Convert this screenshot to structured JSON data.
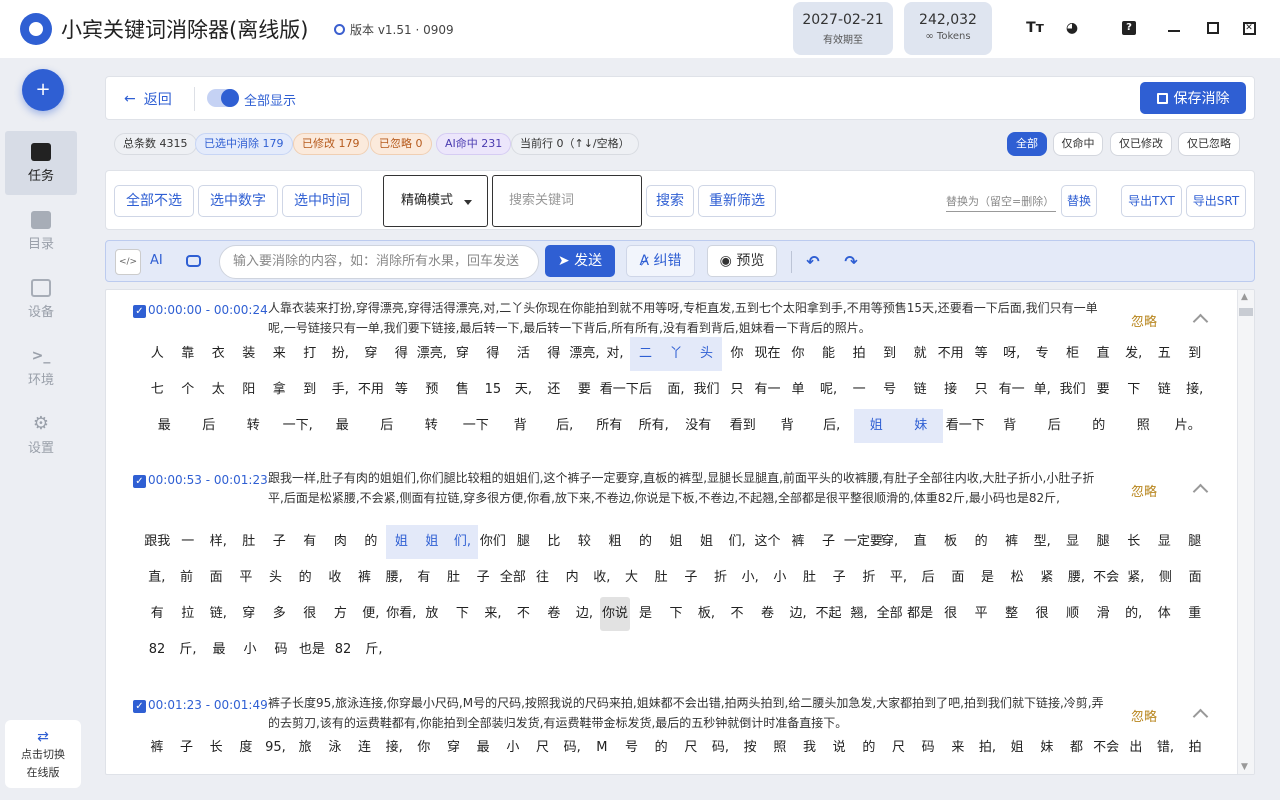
{
  "app": {
    "title": "小宾关键词消除器(离线版)",
    "version": "版本 v1.51 · 0909",
    "expiry_date": "2027-02-21",
    "expiry_label": "有效期至",
    "tokens_value": "242,032",
    "tokens_label": "Tokens",
    "accent_color": "#2f5fd3"
  },
  "sidebar": {
    "items": [
      {
        "label": "任务",
        "icon": "task-icon"
      },
      {
        "label": "目录",
        "icon": "folder-icon"
      },
      {
        "label": "设备",
        "icon": "device-icon"
      },
      {
        "label": "环境",
        "icon": "terminal-icon"
      },
      {
        "label": "设置",
        "icon": "gear-icon"
      }
    ],
    "switch_line1": "点击切换",
    "switch_line2": "在线版"
  },
  "toolbar": {
    "back_label": "返回",
    "toggle_label": "全部显示",
    "save_label": "保存消除"
  },
  "stats": {
    "total": "总条数 4315",
    "selected": "已选中消除 179",
    "modified": "已修改 179",
    "ignored": "已忽略 0",
    "ai_hit": "AI命中 231",
    "current_row": "当前行 0（↑↓/空格）",
    "filters": [
      "全部",
      "仅命中",
      "仅已修改",
      "仅已忽略"
    ]
  },
  "filter": {
    "deselect_all": "全部不选",
    "select_numbers": "选中数字",
    "select_time": "选中时间",
    "mode": "精确模式",
    "keyword_placeholder": "搜索关键词",
    "search": "搜索",
    "refilter": "重新筛选",
    "replace_placeholder": "替换为（留空=删除）",
    "replace": "替换",
    "export_txt": "导出TXT",
    "export_srt": "导出SRT"
  },
  "ai_bar": {
    "ai_label": "AI",
    "input_placeholder": "输入要消除的内容，如：消除所有水果，回车发送",
    "send": "发送",
    "fix": "纠错",
    "preview": "预览"
  },
  "segments": [
    {
      "time_start": "00:00:00",
      "time_end": "00:00:24",
      "text": "人靠衣装来打扮,穿得漂亮,穿得活得漂亮,对,二丫头你现在你能拍到就不用等呀,专柜直发,五到七个太阳拿到手,不用等预售15天,还要看一下后面,我们只有一单呢,一号链接只有一单,我们要下链接,最后转一下,最后转一下背后,所有所有,没有看到背后,姐妹看一下背后的照片。",
      "action": "忽略",
      "rows": [
        [
          "人",
          "靠",
          "衣",
          "装",
          "来",
          "打",
          "扮,",
          "穿",
          "得",
          "漂亮,",
          "穿",
          "得",
          "活",
          "得",
          "漂亮,",
          "对,",
          "二",
          "丫",
          "头",
          "你",
          "现在",
          "你",
          "能",
          "拍",
          "到",
          "就",
          "不用",
          "等",
          "呀,",
          "专",
          "柜",
          "直",
          "发,",
          "五",
          "到"
        ],
        [
          "七",
          "个",
          "太",
          "阳",
          "拿",
          "到",
          "手,",
          "不用",
          "等",
          "预",
          "售",
          "15",
          "天,",
          "还",
          "要",
          "看一下",
          "后",
          "面,",
          "我们",
          "只",
          "有一",
          "单",
          "呢,",
          "一",
          "号",
          "链",
          "接",
          "只",
          "有一",
          "单,",
          "我们",
          "要",
          "下",
          "链",
          "接,"
        ],
        [
          "最",
          "后",
          "转",
          "一下,",
          "最",
          "后",
          "转",
          "一下",
          "背",
          "后,",
          "所有",
          "所有,",
          "没有",
          "看到",
          "背",
          "后,",
          "姐",
          "妹",
          "看一下",
          "背",
          "后",
          "的",
          "照",
          "片。"
        ]
      ]
    },
    {
      "time_start": "00:00:53",
      "time_end": "00:01:23",
      "text": "跟我一样,肚子有肉的姐姐们,你们腿比较粗的姐姐们,这个裤子一定要穿,直板的裤型,显腿长显腿直,前面平头的收裤腰,有肚子全部往内收,大肚子折小,小肚子折平,后面是松紧腰,不会紧,侧面有拉链,穿多很方便,你看,放下来,不卷边,你说是下板,不卷边,不起翘,全部都是很平整很顺滑的,体重82斤,最小码也是82斤,",
      "action": "忽略",
      "rows": [
        [
          "跟我",
          "一",
          "样,",
          "肚",
          "子",
          "有",
          "肉",
          "的",
          "姐",
          "姐",
          "们,",
          "你们",
          "腿",
          "比",
          "较",
          "粗",
          "的",
          "姐",
          "姐",
          "们,",
          "这个",
          "裤",
          "子",
          "一定要",
          "穿,",
          "直",
          "板",
          "的",
          "裤",
          "型,",
          "显",
          "腿",
          "长",
          "显",
          "腿"
        ],
        [
          "直,",
          "前",
          "面",
          "平",
          "头",
          "的",
          "收",
          "裤",
          "腰,",
          "有",
          "肚",
          "子",
          "全部",
          "往",
          "内",
          "收,",
          "大",
          "肚",
          "子",
          "折",
          "小,",
          "小",
          "肚",
          "子",
          "折",
          "平,",
          "后",
          "面",
          "是",
          "松",
          "紧",
          "腰,",
          "不会",
          "紧,",
          "侧",
          "面"
        ],
        [
          "有",
          "拉",
          "链,",
          "穿",
          "多",
          "很",
          "方",
          "便,",
          "你看,",
          "放",
          "下",
          "来,",
          "不",
          "卷",
          "边,",
          "你说",
          "是",
          "下",
          "板,",
          "不",
          "卷",
          "边,",
          "不起",
          "翘,",
          "全部",
          "都是",
          "很",
          "平",
          "整",
          "很",
          "顺",
          "滑",
          "的,",
          "体",
          "重"
        ],
        [
          "82",
          "斤,",
          "最",
          "小",
          "码",
          "也是",
          "82",
          "斤,"
        ]
      ]
    },
    {
      "time_start": "00:01:23",
      "time_end": "00:01:49",
      "text": "裤子长度95,旅泳连接,你穿最小尺码,M号的尺码,按照我说的尺码来拍,姐妹都不会出错,拍两头拍到,给二腰头加急发,大家都拍到了吧,拍到我们就下链接,冷剪,弄的去剪刀,该有的运费鞋都有,你能拍到全部装归发货,有运费鞋带金标发货,最后的五秒钟就倒计时准备直接下。",
      "action": "忽略",
      "rows": [
        [
          "裤",
          "子",
          "长",
          "度",
          "95,",
          "旅",
          "泳",
          "连",
          "接,",
          "你",
          "穿",
          "最",
          "小",
          "尺",
          "码,",
          "M",
          "号",
          "的",
          "尺",
          "码,",
          "按",
          "照",
          "我",
          "说",
          "的",
          "尺",
          "码",
          "来",
          "拍,",
          "姐",
          "妹",
          "都",
          "不会",
          "出",
          "错,",
          "拍"
        ]
      ]
    }
  ]
}
